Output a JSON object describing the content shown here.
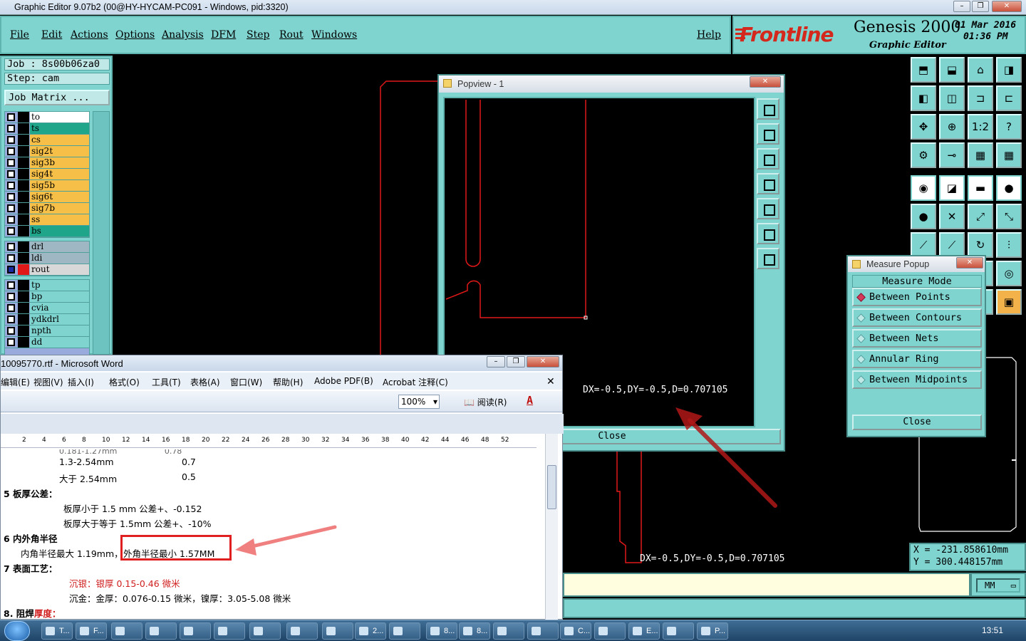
{
  "window": {
    "title": "Graphic Editor 9.07b2 (00@HY-HYCAM-PC091 - Windows, pid:3320)"
  },
  "menu": {
    "items": [
      "File",
      "Actions",
      "Options",
      "Analysis",
      "DFM",
      "Step",
      "Rout",
      "Windows"
    ],
    "help": "Help"
  },
  "brand": {
    "logo": "Frontline",
    "product": "Genesis 2000",
    "subtitle": "Graphic Editor",
    "date": "01 Mar 2016",
    "time": "01:36 PM"
  },
  "job": {
    "job_line": "Job : 8s00b06za0",
    "step_line": "Step: cam",
    "matrix_button": "Job Matrix ..."
  },
  "layers": {
    "group1": [
      {
        "name": "to",
        "color": "#ffffff"
      },
      {
        "name": "ts",
        "color": "#1ea58a"
      },
      {
        "name": "cs",
        "color": "#f6bf47"
      },
      {
        "name": "sig2t",
        "color": "#f6bf47"
      },
      {
        "name": "sig3b",
        "color": "#f6bf47"
      },
      {
        "name": "sig4t",
        "color": "#f6bf47"
      },
      {
        "name": "sig5b",
        "color": "#f6bf47"
      },
      {
        "name": "sig6t",
        "color": "#f6bf47"
      },
      {
        "name": "sig7b",
        "color": "#f6bf47"
      },
      {
        "name": "ss",
        "color": "#f6bf47"
      },
      {
        "name": "bs",
        "color": "#1ea58a"
      }
    ],
    "group2": [
      {
        "name": "drl",
        "color": "#9fb7c2"
      },
      {
        "name": "ldi",
        "color": "#9fb7c2"
      },
      {
        "name": "rout",
        "color": "#d8d8d8"
      }
    ],
    "group3": [
      {
        "name": "tp",
        "color": "#7fd4d0"
      },
      {
        "name": "bp",
        "color": "#7fd4d0"
      },
      {
        "name": "cvia",
        "color": "#7fd4d0"
      },
      {
        "name": "ydkdrl",
        "color": "#7fd4d0"
      },
      {
        "name": "npth",
        "color": "#7fd4d0"
      },
      {
        "name": "dd",
        "color": "#7fd4d0"
      }
    ]
  },
  "popview": {
    "title": "Popview - 1",
    "measure_text": "DX=-0.5,DY=-0.5,D=0.707105",
    "close": "Close"
  },
  "canvas": {
    "measure_text": "DX=-0.5,DY=-0.5,D=0.707105"
  },
  "measure_popup": {
    "title": "Measure Popup",
    "header": "Measure Mode",
    "options": [
      "Between Points",
      "Between Contours",
      "Between Nets",
      "Annular Ring",
      "Between Midpoints"
    ],
    "selected": "Between Points",
    "close": "Close"
  },
  "coords": {
    "x": "X = -231.858610mm",
    "y": "Y =  300.448157mm"
  },
  "units": {
    "value": "MM"
  },
  "word": {
    "title": "10095770.rtf - Microsoft Word",
    "menu": [
      "编辑(E)",
      "视图(V)",
      "插入(I)",
      "格式(O)",
      "工具(T)",
      "表格(A)",
      "窗口(W)",
      "帮助(H)",
      "Adobe PDF(B)",
      "Acrobat 注释(C)"
    ],
    "zoom": "100%",
    "read": "阅读(R)",
    "ruler": [
      "2",
      "4",
      "6",
      "8",
      "10",
      "12",
      "14",
      "16",
      "18",
      "20",
      "22",
      "24",
      "26",
      "28",
      "30",
      "32",
      "34",
      "36",
      "38",
      "40",
      "42",
      "44",
      "46",
      "48",
      "52"
    ],
    "lines": {
      "l1a": "1.3-2.54mm",
      "l1b": "0.7",
      "l2a": "大于 2.54mm",
      "l2b": "0.5",
      "h5": "5 板厚公差：",
      "l3": "板厚小于 1.5  mm    公差+、-0.152",
      "l4": "板厚大于等于 1.5mm  公差+、-10%",
      "h6": "6 内外角半径",
      "l5a": "内角半径最大 1.19mm，",
      "l5b": "外角半径最小 1.57MM",
      "h7": "7 表面工艺：",
      "l6": "沉银：银厚 0.15-0.46 微米",
      "l7": "沉金：金厚：0.076-0.15 微米，镍厚：3.05-5.08 微米",
      "h8a": "8. 阻焊",
      "h8b": "厚度："
    }
  },
  "taskbar": {
    "items": [
      "T...",
      "F...",
      "",
      "",
      "",
      "",
      "",
      "",
      "",
      "2...",
      "",
      "8...",
      "8...",
      "",
      "",
      "C...",
      "",
      "E...",
      "",
      "P..."
    ],
    "clock": "13:51"
  }
}
